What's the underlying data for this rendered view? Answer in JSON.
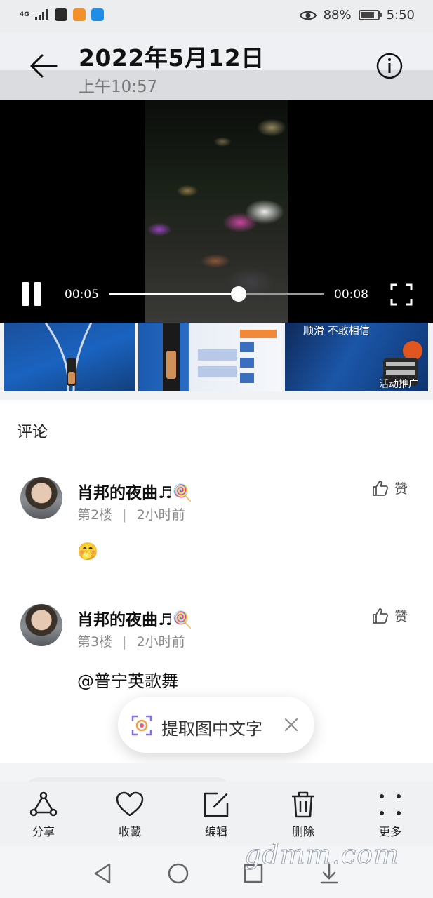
{
  "status_bar": {
    "signal": "4G",
    "battery_percent": 88,
    "battery_text": "88%",
    "time": "5:50",
    "colors": {
      "app1": "#2b2b2b",
      "app2": "#f4902a",
      "app3": "#1e8ee6"
    }
  },
  "header": {
    "date": "2022年5月12日",
    "time": "上午10:57",
    "back_icon": "arrow-left-icon",
    "info_icon": "info-circle-icon"
  },
  "video": {
    "current_time": "00:05",
    "total_time": "00:08",
    "progress_fraction": 0.6,
    "pause_icon": "pause-icon",
    "fullscreen_icon": "fullscreen-icon"
  },
  "ads": {
    "items": [
      {
        "caption": ""
      },
      {
        "caption": ""
      },
      {
        "caption": "顺滑 不敢相信",
        "tag": "活动推广"
      }
    ]
  },
  "comments_section": {
    "title": "评论",
    "like_label": "赞",
    "items": [
      {
        "name": "肖邦的夜曲♬🍭",
        "floor": "第2楼",
        "time": "2小时前",
        "body": "🤭"
      },
      {
        "name": "肖邦的夜曲♬🍭",
        "floor": "第3楼",
        "time": "2小时前",
        "body": "@普宁英歌舞"
      }
    ],
    "meta_separator": "|"
  },
  "toast": {
    "label": "提取图中文字",
    "icon": "text-extract-icon",
    "close_icon": "close-icon"
  },
  "toolbar": {
    "items": [
      {
        "label": "分享",
        "icon": "share-icon"
      },
      {
        "label": "收藏",
        "icon": "heart-icon"
      },
      {
        "label": "编辑",
        "icon": "edit-icon"
      },
      {
        "label": "删除",
        "icon": "trash-icon"
      },
      {
        "label": "更多",
        "icon": "more-icon"
      }
    ]
  },
  "nav": {
    "back_icon": "nav-back-icon",
    "home_icon": "nav-home-icon",
    "recent_icon": "nav-recent-icon",
    "down_icon": "nav-down-icon"
  },
  "watermark": "gdmm.com"
}
